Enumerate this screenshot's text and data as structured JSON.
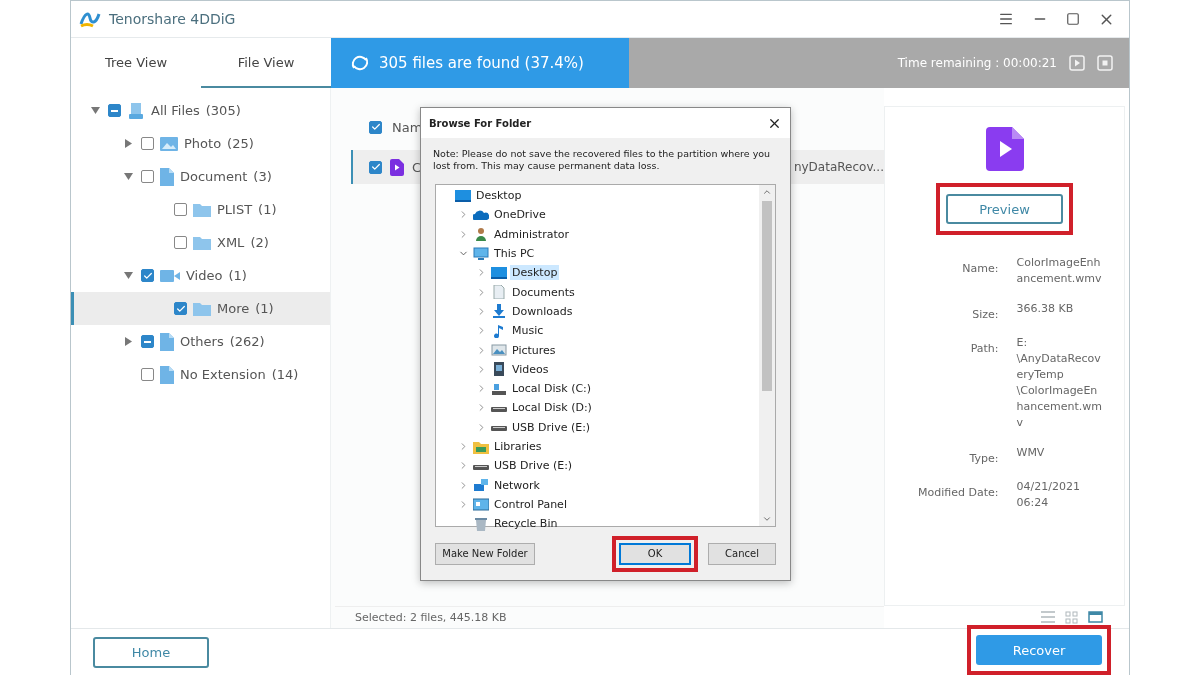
{
  "app": {
    "title": "Tenorshare 4DDiG"
  },
  "view_tabs": [
    {
      "label": "Tree View",
      "selected": false
    },
    {
      "label": "File View",
      "selected": true
    }
  ],
  "scan": {
    "status": "305 files are found (37.4%)",
    "level": 0.374,
    "time_remaining": "Time remaining : 00:00:21"
  },
  "tree": [
    {
      "label": "All Files",
      "count": "(305)",
      "kind": "drive",
      "checked": true,
      "partial": true,
      "expanded": true,
      "selected": false,
      "children": [
        {
          "label": "Photo",
          "count": "(25)",
          "kind": "photo",
          "checked": false,
          "partial": false,
          "expanded": false,
          "selected": false
        },
        {
          "label": "Document",
          "count": "(3)",
          "kind": "doc",
          "checked": false,
          "partial": false,
          "expanded": true,
          "selected": false,
          "children": [
            {
              "label": "PLIST",
              "count": "(1)",
              "kind": "folder",
              "checked": false,
              "partial": false,
              "selected": false
            },
            {
              "label": "XML",
              "count": "(2)",
              "kind": "folder",
              "checked": false,
              "partial": false,
              "selected": false
            }
          ]
        },
        {
          "label": "Video",
          "count": "(1)",
          "kind": "video",
          "checked": true,
          "partial": false,
          "expanded": true,
          "selected": false,
          "children": [
            {
              "label": "More",
              "count": "(1)",
              "kind": "folder",
              "checked": true,
              "partial": false,
              "selected": true
            }
          ]
        },
        {
          "label": "Others",
          "count": "(262)",
          "kind": "doc",
          "checked": true,
          "partial": true,
          "expanded": false,
          "selected": false
        },
        {
          "label": "No Extension",
          "count": "(14)",
          "kind": "doc",
          "checked": false,
          "partial": false,
          "selected": false
        }
      ]
    }
  ],
  "file_list": {
    "header": {
      "checked": true,
      "text": "Nam"
    },
    "rows": [
      {
        "checked": true,
        "selected": true,
        "name": "C",
        "path": "nyDataRecov..."
      }
    ]
  },
  "status": "Selected: 2 files, 445.18 KB",
  "details": {
    "preview": "Preview",
    "fields": [
      {
        "label": "Name:",
        "value": "ColorImageEnhancement.wmv"
      },
      {
        "label": "Size:",
        "value": "366.38 KB"
      },
      {
        "label": "Path:",
        "value": "E: \\AnyDataRecoveryTemp \\ColorImageEnhancement.wmv"
      },
      {
        "label": "Type:",
        "value": "WMV"
      },
      {
        "label": "Modified Date:",
        "value": "04/21/2021 06:24"
      }
    ]
  },
  "view_modes": [
    {
      "kind": "list",
      "selected": false
    },
    {
      "kind": "grid",
      "selected": false
    },
    {
      "kind": "preview",
      "selected": true
    }
  ],
  "dialog": {
    "title": "Browse For Folder",
    "note": "Note: Please do not save the recovered files to the partition where you lost from. This may cause permanent data loss.",
    "tree": [
      {
        "label": "Desktop",
        "kind": "desktop",
        "selected": false,
        "children": [
          {
            "label": "OneDrive",
            "kind": "cloud",
            "expanded": false,
            "selected": false
          },
          {
            "label": "Administrator",
            "kind": "user",
            "expanded": false,
            "selected": false
          },
          {
            "label": "This PC",
            "kind": "pc",
            "expanded": true,
            "selected": false,
            "children": [
              {
                "label": "Desktop",
                "kind": "desktop",
                "expanded": false,
                "selected": true
              },
              {
                "label": "Documents",
                "kind": "documents",
                "expanded": false,
                "selected": false
              },
              {
                "label": "Downloads",
                "kind": "download",
                "expanded": false,
                "selected": false
              },
              {
                "label": "Music",
                "kind": "music",
                "expanded": false,
                "selected": false
              },
              {
                "label": "Pictures",
                "kind": "pictures",
                "expanded": false,
                "selected": false
              },
              {
                "label": "Videos",
                "kind": "videos",
                "expanded": false,
                "selected": false
              },
              {
                "label": "Local Disk (C:)",
                "kind": "system",
                "expanded": false,
                "selected": false
              },
              {
                "label": "Local Disk (D:)",
                "kind": "disk",
                "expanded": false,
                "selected": false
              },
              {
                "label": "USB Drive (E:)",
                "kind": "disk",
                "expanded": false,
                "selected": false
              }
            ]
          },
          {
            "label": "Libraries",
            "kind": "libraries",
            "expanded": false,
            "selected": false
          },
          {
            "label": "USB Drive (E:)",
            "kind": "disk",
            "expanded": false,
            "selected": false
          },
          {
            "label": "Network",
            "kind": "network",
            "expanded": false,
            "selected": false
          },
          {
            "label": "Control Panel",
            "kind": "control",
            "expanded": false,
            "selected": false
          },
          {
            "label": "Recycle Bin",
            "kind": "recycle",
            "selected": false
          }
        ]
      }
    ],
    "make_folder": "Make New Folder",
    "ok": "OK",
    "cancel": "Cancel"
  },
  "actions": {
    "home": "Home",
    "recover": "Recover"
  }
}
